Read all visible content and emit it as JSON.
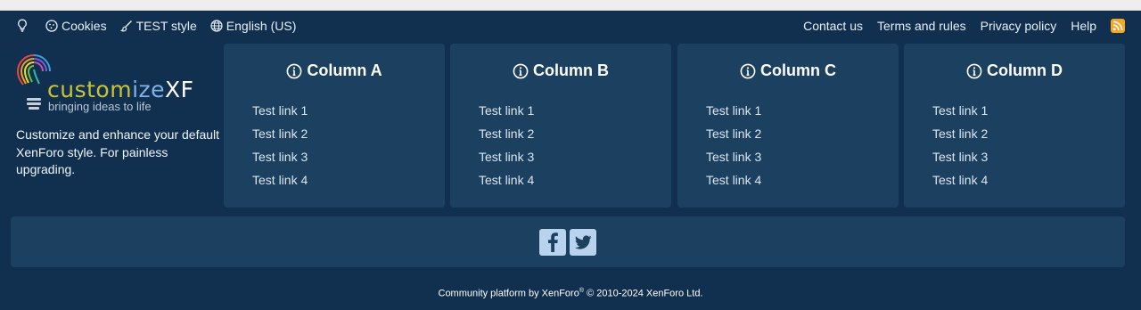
{
  "topbar": {
    "cookies": "Cookies",
    "style": "TEST style",
    "language": "English (US)",
    "contact": "Contact us",
    "terms": "Terms and rules",
    "privacy": "Privacy policy",
    "help": "Help"
  },
  "brand": {
    "logo_word_1": "custom",
    "logo_word_2": "ize",
    "logo_word_3": "XF",
    "tagline": "bringing ideas to life",
    "description": "Customize and enhance your default XenForo style. For painless upgrading."
  },
  "columns": [
    {
      "title": "Column A",
      "links": [
        "Test link 1",
        "Test link 2",
        "Test link 3",
        "Test link 4"
      ]
    },
    {
      "title": "Column B",
      "links": [
        "Test link 1",
        "Test link 2",
        "Test link 3",
        "Test link 4"
      ]
    },
    {
      "title": "Column C",
      "links": [
        "Test link 1",
        "Test link 2",
        "Test link 3",
        "Test link 4"
      ]
    },
    {
      "title": "Column D",
      "links": [
        "Test link 1",
        "Test link 2",
        "Test link 3",
        "Test link 4"
      ]
    }
  ],
  "social": [
    "facebook-icon",
    "twitter-icon"
  ],
  "copyright": {
    "prefix": "Community platform by XenForo",
    "reg": "®",
    "suffix": " © 2010-2024 XenForo Ltd."
  },
  "colors": {
    "background": "#11304f",
    "panel": "#1b4060",
    "rss": "#f5a623",
    "social_button": "#b9d3ee"
  }
}
